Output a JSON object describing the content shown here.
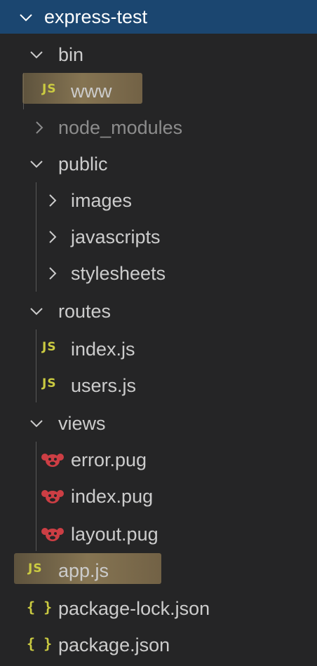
{
  "explorer": {
    "root": {
      "label": "express-test"
    },
    "items": [
      {
        "label": "bin",
        "type": "folder",
        "expanded": true
      },
      {
        "label": "www",
        "type": "js-file",
        "icon": "js-icon",
        "highlighted": true
      },
      {
        "label": "node_modules",
        "type": "folder",
        "expanded": false
      },
      {
        "label": "public",
        "type": "folder",
        "expanded": true
      },
      {
        "label": "images",
        "type": "folder",
        "expanded": false
      },
      {
        "label": "javascripts",
        "type": "folder",
        "expanded": false
      },
      {
        "label": "stylesheets",
        "type": "folder",
        "expanded": false
      },
      {
        "label": "routes",
        "type": "folder",
        "expanded": true
      },
      {
        "label": "index.js",
        "type": "js-file",
        "icon": "js-icon"
      },
      {
        "label": "users.js",
        "type": "js-file",
        "icon": "js-icon"
      },
      {
        "label": "views",
        "type": "folder",
        "expanded": true
      },
      {
        "label": "error.pug",
        "type": "pug-file",
        "icon": "pug-icon"
      },
      {
        "label": "index.pug",
        "type": "pug-file",
        "icon": "pug-icon"
      },
      {
        "label": "layout.pug",
        "type": "pug-file",
        "icon": "pug-icon"
      },
      {
        "label": "app.js",
        "type": "js-file",
        "icon": "js-icon",
        "highlighted": true
      },
      {
        "label": "package-lock.json",
        "type": "json-file",
        "icon": "json-icon"
      },
      {
        "label": "package.json",
        "type": "json-file",
        "icon": "json-icon"
      }
    ],
    "icons": {
      "js_text": "JS",
      "json_text": "{ }"
    },
    "colors": {
      "background": "#252526",
      "root_bar": "#1b4670",
      "text": "#cccccc",
      "dimmed_text": "#8c8c8c",
      "js_icon": "#cbcb41",
      "pug_icon": "#cc3e44",
      "highlight": "#8c7850"
    }
  }
}
